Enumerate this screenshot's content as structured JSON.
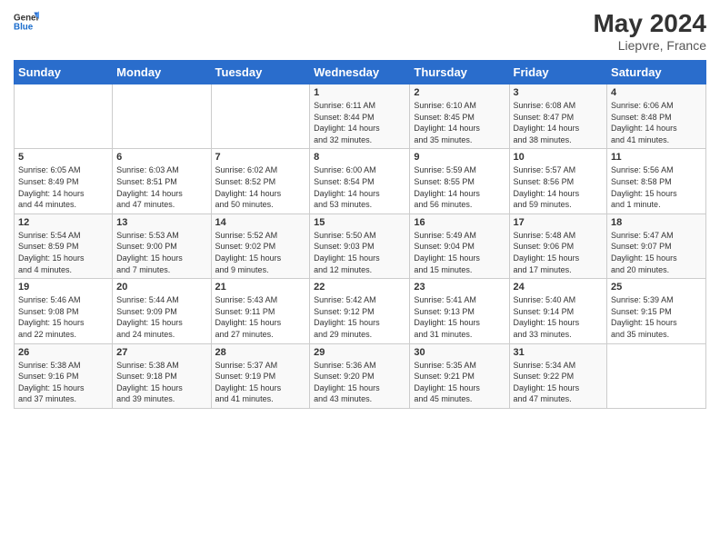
{
  "header": {
    "logo_general": "General",
    "logo_blue": "Blue",
    "month_year": "May 2024",
    "location": "Liepvre, France"
  },
  "days_of_week": [
    "Sunday",
    "Monday",
    "Tuesday",
    "Wednesday",
    "Thursday",
    "Friday",
    "Saturday"
  ],
  "weeks": [
    [
      {
        "day": "",
        "info": ""
      },
      {
        "day": "",
        "info": ""
      },
      {
        "day": "",
        "info": ""
      },
      {
        "day": "1",
        "info": "Sunrise: 6:11 AM\nSunset: 8:44 PM\nDaylight: 14 hours\nand 32 minutes."
      },
      {
        "day": "2",
        "info": "Sunrise: 6:10 AM\nSunset: 8:45 PM\nDaylight: 14 hours\nand 35 minutes."
      },
      {
        "day": "3",
        "info": "Sunrise: 6:08 AM\nSunset: 8:47 PM\nDaylight: 14 hours\nand 38 minutes."
      },
      {
        "day": "4",
        "info": "Sunrise: 6:06 AM\nSunset: 8:48 PM\nDaylight: 14 hours\nand 41 minutes."
      }
    ],
    [
      {
        "day": "5",
        "info": "Sunrise: 6:05 AM\nSunset: 8:49 PM\nDaylight: 14 hours\nand 44 minutes."
      },
      {
        "day": "6",
        "info": "Sunrise: 6:03 AM\nSunset: 8:51 PM\nDaylight: 14 hours\nand 47 minutes."
      },
      {
        "day": "7",
        "info": "Sunrise: 6:02 AM\nSunset: 8:52 PM\nDaylight: 14 hours\nand 50 minutes."
      },
      {
        "day": "8",
        "info": "Sunrise: 6:00 AM\nSunset: 8:54 PM\nDaylight: 14 hours\nand 53 minutes."
      },
      {
        "day": "9",
        "info": "Sunrise: 5:59 AM\nSunset: 8:55 PM\nDaylight: 14 hours\nand 56 minutes."
      },
      {
        "day": "10",
        "info": "Sunrise: 5:57 AM\nSunset: 8:56 PM\nDaylight: 14 hours\nand 59 minutes."
      },
      {
        "day": "11",
        "info": "Sunrise: 5:56 AM\nSunset: 8:58 PM\nDaylight: 15 hours\nand 1 minute."
      }
    ],
    [
      {
        "day": "12",
        "info": "Sunrise: 5:54 AM\nSunset: 8:59 PM\nDaylight: 15 hours\nand 4 minutes."
      },
      {
        "day": "13",
        "info": "Sunrise: 5:53 AM\nSunset: 9:00 PM\nDaylight: 15 hours\nand 7 minutes."
      },
      {
        "day": "14",
        "info": "Sunrise: 5:52 AM\nSunset: 9:02 PM\nDaylight: 15 hours\nand 9 minutes."
      },
      {
        "day": "15",
        "info": "Sunrise: 5:50 AM\nSunset: 9:03 PM\nDaylight: 15 hours\nand 12 minutes."
      },
      {
        "day": "16",
        "info": "Sunrise: 5:49 AM\nSunset: 9:04 PM\nDaylight: 15 hours\nand 15 minutes."
      },
      {
        "day": "17",
        "info": "Sunrise: 5:48 AM\nSunset: 9:06 PM\nDaylight: 15 hours\nand 17 minutes."
      },
      {
        "day": "18",
        "info": "Sunrise: 5:47 AM\nSunset: 9:07 PM\nDaylight: 15 hours\nand 20 minutes."
      }
    ],
    [
      {
        "day": "19",
        "info": "Sunrise: 5:46 AM\nSunset: 9:08 PM\nDaylight: 15 hours\nand 22 minutes."
      },
      {
        "day": "20",
        "info": "Sunrise: 5:44 AM\nSunset: 9:09 PM\nDaylight: 15 hours\nand 24 minutes."
      },
      {
        "day": "21",
        "info": "Sunrise: 5:43 AM\nSunset: 9:11 PM\nDaylight: 15 hours\nand 27 minutes."
      },
      {
        "day": "22",
        "info": "Sunrise: 5:42 AM\nSunset: 9:12 PM\nDaylight: 15 hours\nand 29 minutes."
      },
      {
        "day": "23",
        "info": "Sunrise: 5:41 AM\nSunset: 9:13 PM\nDaylight: 15 hours\nand 31 minutes."
      },
      {
        "day": "24",
        "info": "Sunrise: 5:40 AM\nSunset: 9:14 PM\nDaylight: 15 hours\nand 33 minutes."
      },
      {
        "day": "25",
        "info": "Sunrise: 5:39 AM\nSunset: 9:15 PM\nDaylight: 15 hours\nand 35 minutes."
      }
    ],
    [
      {
        "day": "26",
        "info": "Sunrise: 5:38 AM\nSunset: 9:16 PM\nDaylight: 15 hours\nand 37 minutes."
      },
      {
        "day": "27",
        "info": "Sunrise: 5:38 AM\nSunset: 9:18 PM\nDaylight: 15 hours\nand 39 minutes."
      },
      {
        "day": "28",
        "info": "Sunrise: 5:37 AM\nSunset: 9:19 PM\nDaylight: 15 hours\nand 41 minutes."
      },
      {
        "day": "29",
        "info": "Sunrise: 5:36 AM\nSunset: 9:20 PM\nDaylight: 15 hours\nand 43 minutes."
      },
      {
        "day": "30",
        "info": "Sunrise: 5:35 AM\nSunset: 9:21 PM\nDaylight: 15 hours\nand 45 minutes."
      },
      {
        "day": "31",
        "info": "Sunrise: 5:34 AM\nSunset: 9:22 PM\nDaylight: 15 hours\nand 47 minutes."
      },
      {
        "day": "",
        "info": ""
      }
    ]
  ]
}
